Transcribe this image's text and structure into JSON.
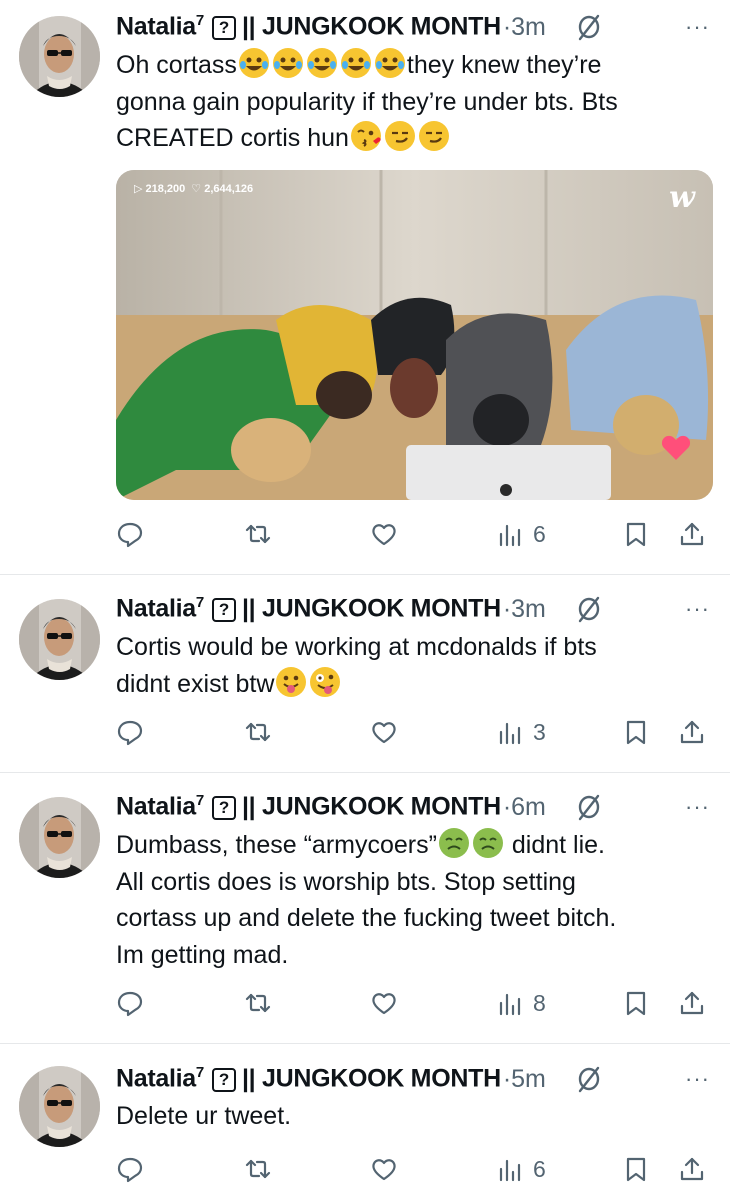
{
  "tweets": [
    {
      "display_name": "Natalia",
      "name_sup": "7",
      "name_mark": "?",
      "name_suffix": "|| JUNGKOOK MONTH",
      "separator": "·",
      "time": "3m",
      "more": "···",
      "lines": [
        {
          "pre": "Oh cortass",
          "emoji": [
            "joy",
            "joy",
            "joy",
            "joy",
            "joy"
          ],
          "post": "they knew they’re"
        },
        {
          "pre": "gonna gain popularity if they’re under bts. Bts",
          "emoji": [],
          "post": ""
        },
        {
          "pre": "CREATED cortis hun",
          "emoji": [
            "kiss",
            "smirk",
            "smirk"
          ],
          "post": ""
        }
      ],
      "media": {
        "views": "▷ 218,200",
        "likes": "♡ 2,644,126",
        "logo": "w"
      },
      "views": "6"
    },
    {
      "display_name": "Natalia",
      "name_sup": "7",
      "name_mark": "?",
      "name_suffix": "|| JUNGKOOK MONTH",
      "separator": "·",
      "time": "3m",
      "more": "···",
      "lines": [
        {
          "pre": "Cortis would be working at mcdonalds if bts",
          "emoji": [],
          "post": ""
        },
        {
          "pre": "didnt exist btw",
          "emoji": [
            "tongue",
            "zany"
          ],
          "post": ""
        }
      ],
      "views": "3"
    },
    {
      "display_name": "Natalia",
      "name_sup": "7",
      "name_mark": "?",
      "name_suffix": "|| JUNGKOOK MONTH",
      "separator": "·",
      "time": "6m",
      "more": "···",
      "lines": [
        {
          "pre": "Dumbass, these “armycoers”",
          "emoji": [
            "sick",
            "sick"
          ],
          "post": " didnt lie."
        },
        {
          "pre": "All cortis does is worship bts. Stop setting",
          "emoji": [],
          "post": ""
        },
        {
          "pre": "cortass up and delete the fucking tweet bitch.",
          "emoji": [],
          "post": ""
        },
        {
          "pre": "Im getting mad.",
          "emoji": [],
          "post": ""
        }
      ],
      "views": "8"
    },
    {
      "display_name": "Natalia",
      "name_sup": "7",
      "name_mark": "?",
      "name_suffix": "|| JUNGKOOK MONTH",
      "separator": "·",
      "time": "5m",
      "more": "···",
      "lines": [
        {
          "pre": "Delete ur tweet.",
          "emoji": [],
          "post": ""
        }
      ],
      "views": "6"
    }
  ],
  "icons": [
    "reply-icon",
    "retweet-icon",
    "like-icon",
    "views-icon",
    "bookmark-icon",
    "share-icon",
    "muted-icon",
    "more-icon"
  ]
}
